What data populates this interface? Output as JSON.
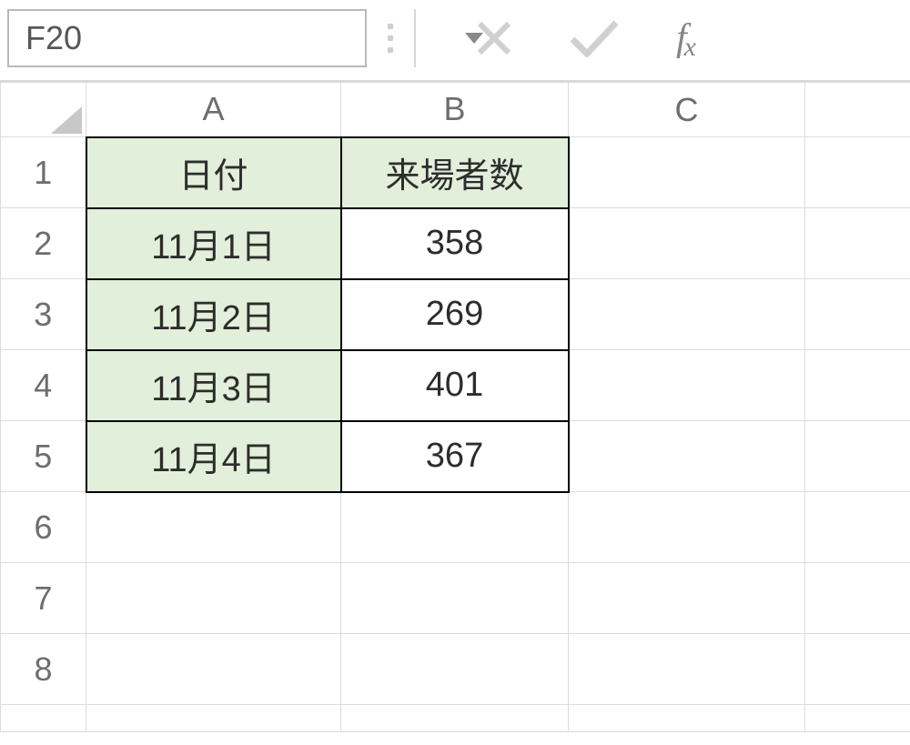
{
  "nameBox": {
    "value": "F20"
  },
  "fx": {
    "label_f": "f",
    "label_x": "x"
  },
  "columns": [
    "A",
    "B",
    "C",
    ""
  ],
  "rows": [
    "1",
    "2",
    "3",
    "4",
    "5",
    "6",
    "7",
    "8",
    ""
  ],
  "cells": {
    "A1": "日付",
    "B1": "来場者数",
    "A2": "11月1日",
    "B2": "358",
    "A3": "11月2日",
    "B3": "269",
    "A4": "11月3日",
    "B4": "401",
    "A5": "11月4日",
    "B5": "367"
  }
}
